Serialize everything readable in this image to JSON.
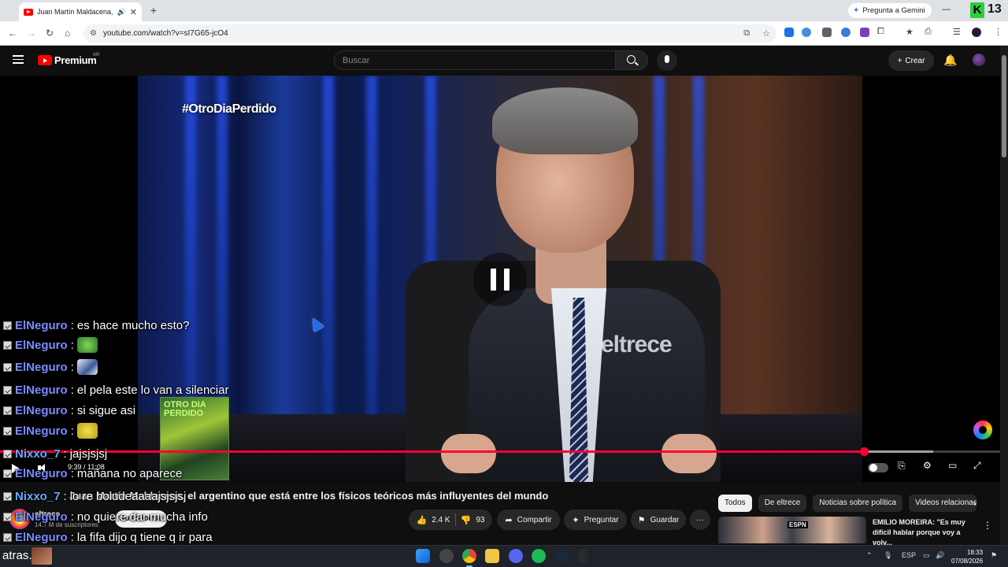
{
  "browser": {
    "tab_title": "Juan Martín Maldacena, el ...",
    "tab_audio_icon": "speaker-icon",
    "tab_close": "✕",
    "new_tab": "+",
    "gemini_label": "Pregunta a Gemini",
    "url": "youtube.com/watch?v=sI7G65-jcO4",
    "counter": "13",
    "k_badge": "K"
  },
  "youtube": {
    "logo_text": "Premium",
    "country": "AR",
    "search_placeholder": "Buscar",
    "create_label": "Crear"
  },
  "player": {
    "overlay_hashtag": "#OtroDiaPerdido",
    "watermark": "eltrece",
    "time_display": "9:39 / 11:08",
    "progress_fraction": 0.864,
    "buffered_fraction": 0.933,
    "sticker_text": "OTRO DIA PERDIDO"
  },
  "chat": [
    {
      "user": "ElNeguro",
      "message": "es hace mucho esto?"
    },
    {
      "user": "ElNeguro",
      "message": "",
      "emote": "frog-emote"
    },
    {
      "user": "ElNeguro",
      "message": "",
      "emote": "photo-emote"
    },
    {
      "user": "ElNeguro",
      "message": "el pela este lo van a silenciar"
    },
    {
      "user": "ElNeguro",
      "message": "si sigue asi"
    },
    {
      "user": "ElNeguro",
      "message": "",
      "emote": "spongebob-emote"
    },
    {
      "user": "Nixxo_7",
      "message": "jajsjsjsj"
    },
    {
      "user": "ElNeguro",
      "message": "mañana no aparece"
    },
    {
      "user": "Nixxo_7",
      "message": "lo re boludeaaaajsjsjsj"
    },
    {
      "user": "ElNeguro",
      "message": "no quiere dar mucha info"
    },
    {
      "user": "ElNeguro",
      "message": "la fifa dijo q tiene q ir para"
    }
  ],
  "video": {
    "title": "Juan Martín Maldacena, el argentino que está entre los físicos teóricos más influyentes del mundo",
    "channel": "eltrece",
    "subscribers": "14.7 M de suscriptores",
    "subscribe_label": "Suscribirse",
    "likes": "2.4 K",
    "dislikes": "93",
    "share_label": "Compartir",
    "ask_label": "Preguntar",
    "save_label": "Guardar",
    "more_label": "···"
  },
  "recommendations": {
    "chips": [
      "Todos",
      "De eltrece",
      "Noticias sobre política",
      "Videos relacionados"
    ],
    "first_title": "EMILIO MOREIRA: \"Es muy difícil hablar porque voy a volv...",
    "thumb_badge": "ESPN"
  },
  "taskbar": {
    "overlay_text": "atras.",
    "language": "ESP",
    "time": "18:33",
    "date": "07/08/2026"
  },
  "colors": {
    "accent": "#ff0033",
    "youtube_red": "#ff0000",
    "chat_user": "#7a8cff"
  }
}
